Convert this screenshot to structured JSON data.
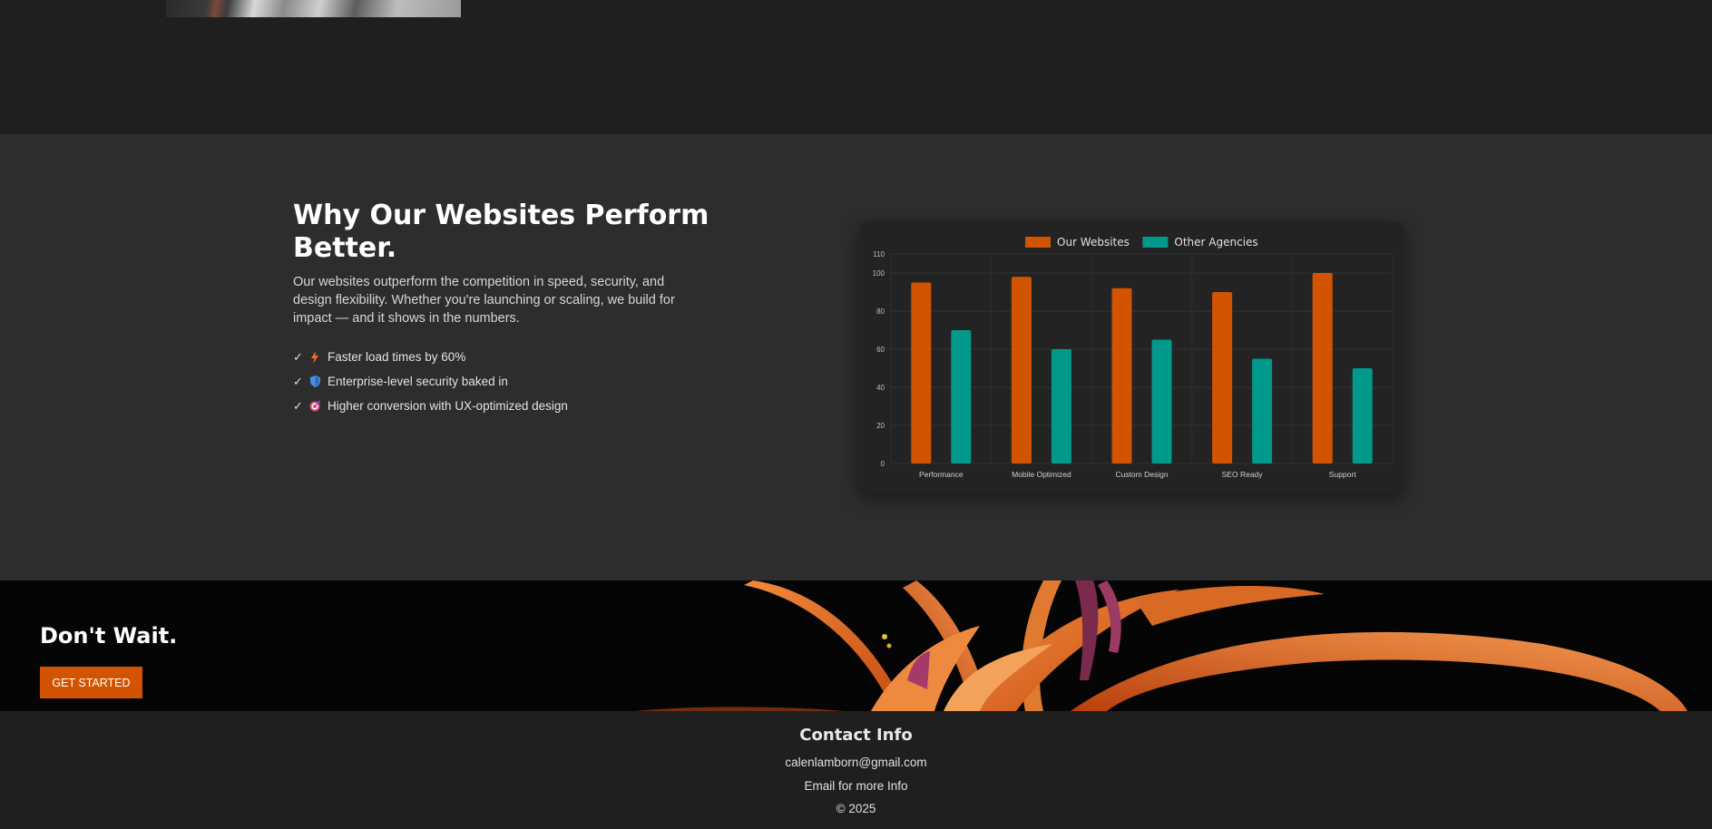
{
  "why": {
    "title": "Why Our Websites Perform Better.",
    "description": "Our websites outperform the competition in speed, security, and design flexibility. Whether you're launching or scaling, we build for impact — and it shows in the numbers.",
    "features": [
      {
        "check": "✓",
        "icon": "lightning-icon",
        "text": "Faster load times by 60%"
      },
      {
        "check": "✓",
        "icon": "shield-icon",
        "text": "Enterprise-level security baked in"
      },
      {
        "check": "✓",
        "icon": "target-icon",
        "text": "Higher conversion with UX-optimized design"
      }
    ]
  },
  "chart_data": {
    "type": "bar",
    "categories": [
      "Performance",
      "Mobile Optimized",
      "Custom Design",
      "SEO Ready",
      "Support"
    ],
    "series": [
      {
        "name": "Our Websites",
        "color": "#d35400",
        "values": [
          95,
          98,
          92,
          90,
          100
        ]
      },
      {
        "name": "Other Agencies",
        "color": "#00998a",
        "values": [
          70,
          60,
          65,
          55,
          50
        ]
      }
    ],
    "y_ticks": [
      "0",
      "20",
      "40",
      "60",
      "80",
      "100",
      "110"
    ],
    "ylim": [
      0,
      110
    ],
    "legend_position": "top",
    "grid": true
  },
  "cta": {
    "title": "Don't Wait.",
    "button_label": "GET STARTED",
    "accent": "#d35400"
  },
  "footer": {
    "title": "Contact Info",
    "email": "calenlamborn@gmail.com",
    "note": "Email for more Info",
    "copyright": "© 2025"
  }
}
